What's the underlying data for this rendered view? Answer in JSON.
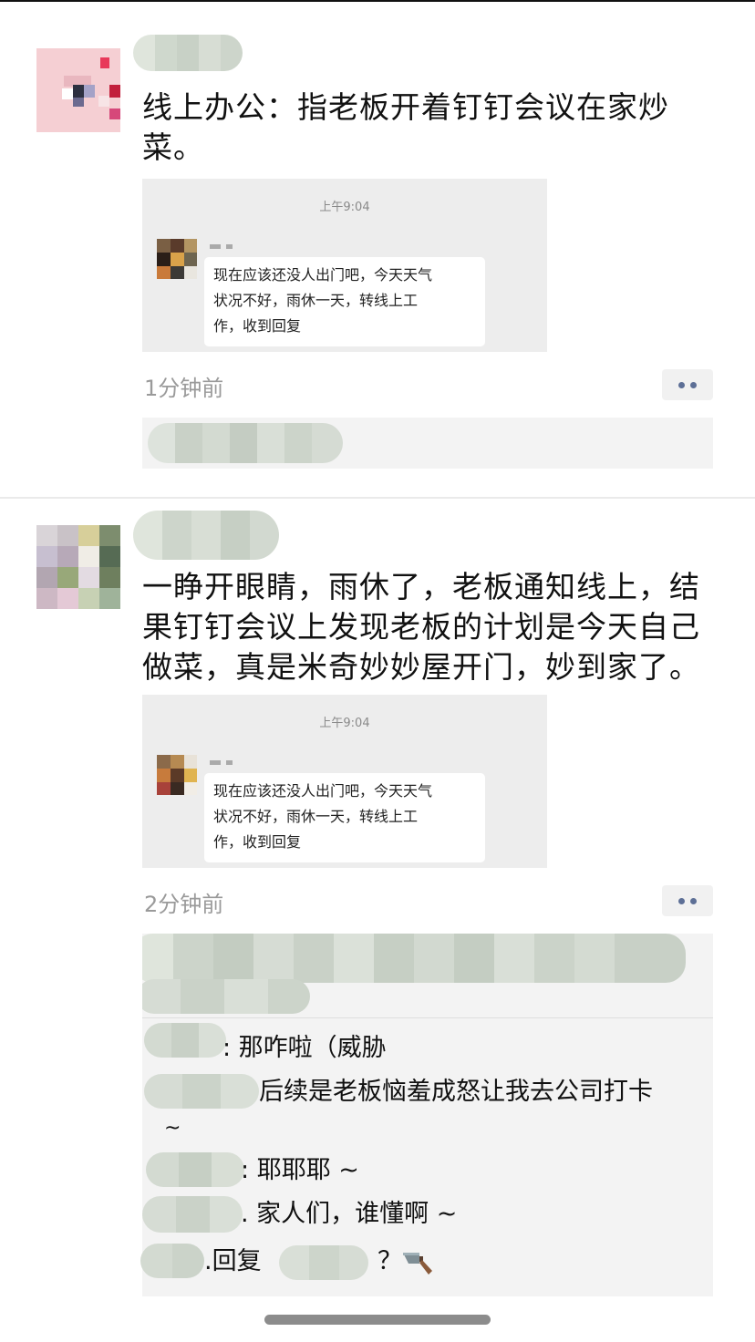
{
  "colors": {
    "link": "#5d6f96",
    "muted": "#9a9a9a",
    "card_bg": "#ededed",
    "comment_bg": "#f3f3f3"
  },
  "posts": [
    {
      "text": "线上办公：指老板开着钉钉会议在家炒菜。",
      "card": {
        "time": "上午9:04",
        "lines": [
          "现在应该还没人出门吧，今天天气",
          "状况不好，雨休一天，转线上工",
          "作，收到回复"
        ]
      },
      "time": "1分钟前",
      "more_icon": "more-dots-icon"
    },
    {
      "text": "一睁开眼睛，雨休了，老板通知线上，结果钉钉会议上发现老板的计划是今天自己做菜，真是米奇妙妙屋开门，妙到家了。",
      "card": {
        "time": "上午9:04",
        "lines": [
          "现在应该还没人出门吧，今天天气",
          "状况不好，雨休一天，转线上工",
          "作，收到回复"
        ]
      },
      "time": "2分钟前",
      "more_icon": "more-dots-icon",
      "comments": [
        {
          "text": ": 那咋啦（威胁"
        },
        {
          "text": "后续是老板恼羞成怒让我去公司打卡"
        },
        {
          "text": "~"
        },
        {
          "text": ": 耶耶耶 ~"
        },
        {
          "text": ". 家人们，谁懂啊 ~"
        },
        {
          "text": ".回复"
        },
        {
          "text": "？"
        }
      ],
      "knife_icon": "kitchen-knife-icon"
    }
  ]
}
